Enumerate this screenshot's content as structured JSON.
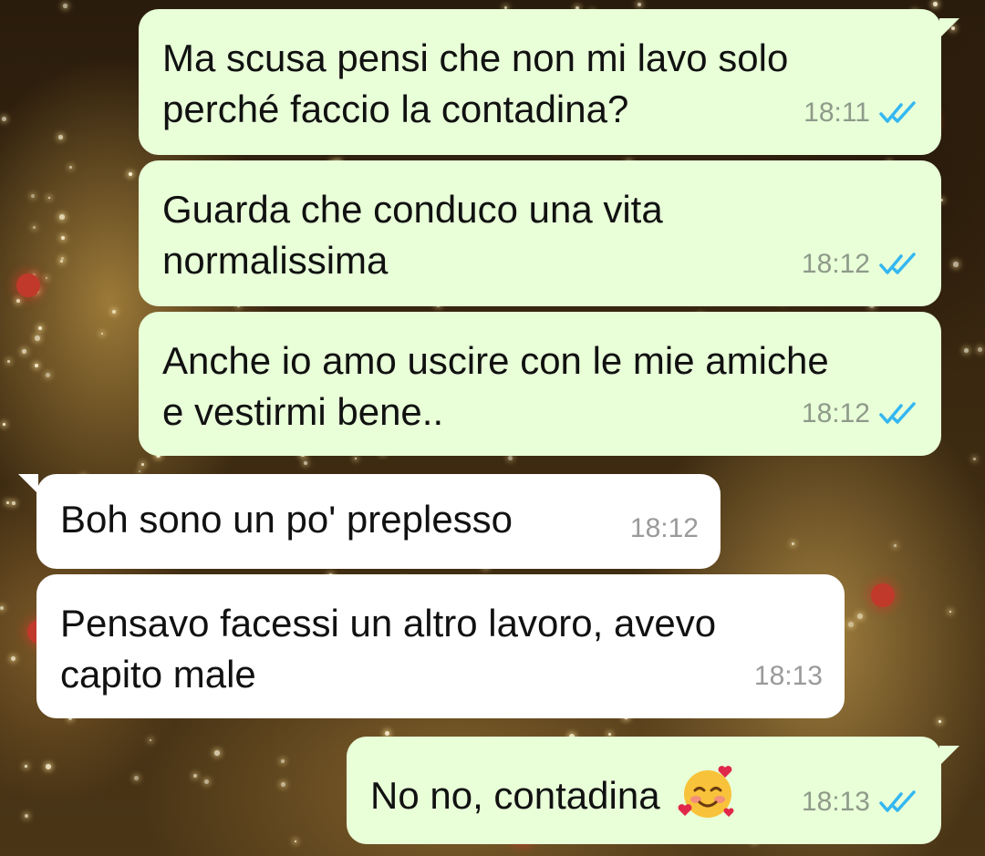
{
  "colors": {
    "outgoing_bubble": "#e8ffd8",
    "incoming_bubble": "#ffffff",
    "read_tick": "#34b7f1"
  },
  "messages": [
    {
      "direction": "outgoing",
      "text_lines": [
        "Ma scusa pensi che non mi lavo solo",
        "perché faccio la contadina?"
      ],
      "time": "18:11",
      "status_icon": "double-check-read-icon"
    },
    {
      "direction": "outgoing",
      "text_lines": [
        "Guarda che conduco una vita",
        "normalissima"
      ],
      "time": "18:12",
      "status_icon": "double-check-read-icon"
    },
    {
      "direction": "outgoing",
      "text_lines": [
        "Anche io amo uscire con le mie amiche",
        "e vestirmi bene.."
      ],
      "time": "18:12",
      "status_icon": "double-check-read-icon"
    },
    {
      "direction": "incoming",
      "text_lines": [
        "Boh sono un po' preplesso"
      ],
      "time": "18:12"
    },
    {
      "direction": "incoming",
      "text_lines": [
        "Pensavo facessi un altro lavoro, avevo",
        "capito male"
      ],
      "time": "18:13"
    },
    {
      "direction": "outgoing",
      "text_lines": [
        "No no, contadina"
      ],
      "emoji": "smiling-face-with-hearts-icon",
      "time": "18:13",
      "status_icon": "double-check-read-icon"
    }
  ]
}
